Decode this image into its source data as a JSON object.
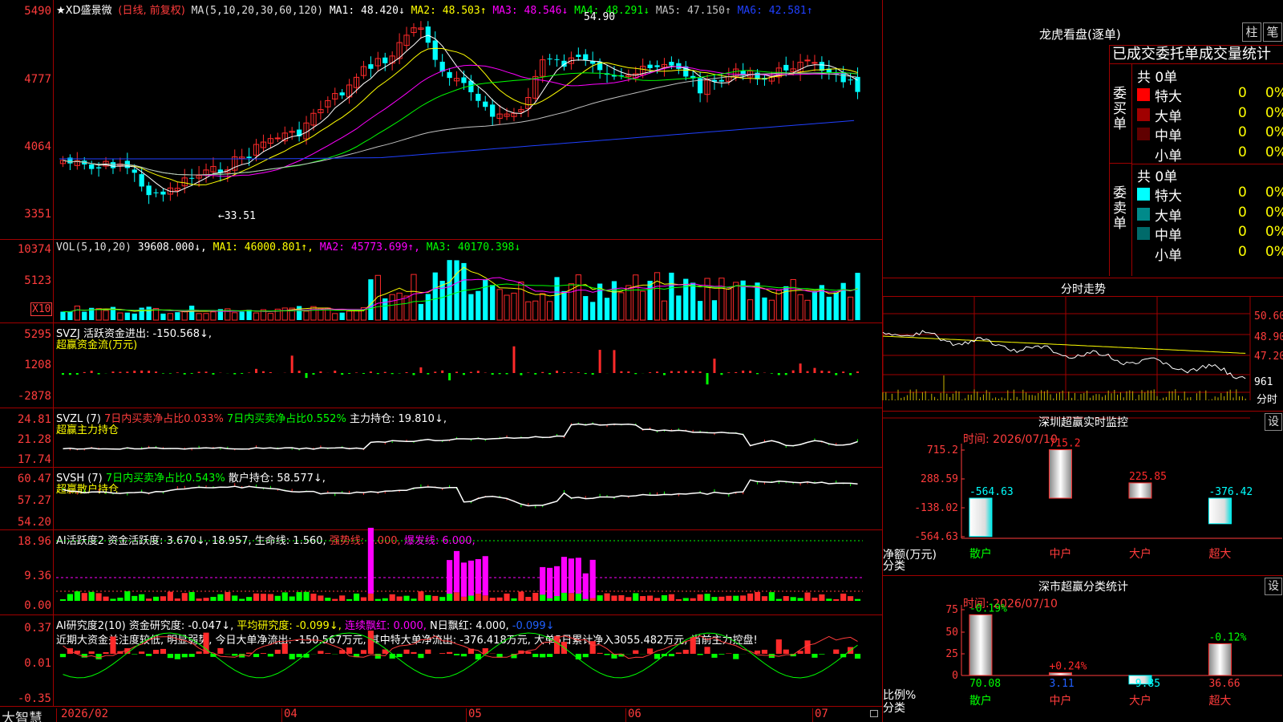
{
  "colors": {
    "up": "#ff2a2a",
    "down": "#00ffff",
    "bg": "#000000",
    "grid": "#a00000"
  },
  "price": {
    "stock_name": "★XD盛景微",
    "adjust": "(日线, 前复权)",
    "ma_params": "MA(5,10,20,30,60,120)",
    "ma": [
      {
        "label": "MA1: 48.420↓",
        "color": "#ffffff"
      },
      {
        "label": "MA2: 48.503↑",
        "color": "#ffff00"
      },
      {
        "label": "MA3: 48.546↓",
        "color": "#ff00ff"
      },
      {
        "label": "MA4: 48.291↓",
        "color": "#00ff00"
      },
      {
        "label": "MA5: 47.150↑",
        "color": "#c0c0c0"
      },
      {
        "label": "MA6: 42.581↑",
        "color": "#2040ff"
      }
    ],
    "y_labels": [
      "5490",
      "4777",
      "4064",
      "3351"
    ],
    "high_note": "54.90",
    "low_note": "←33.51"
  },
  "vol": {
    "title": "VOL(5,10,20)",
    "value": "39608.000↓,",
    "ma": [
      {
        "label": "MA1: 46000.801↑,",
        "color": "#ffff00"
      },
      {
        "label": "MA2: 45773.699↑,",
        "color": "#ff00ff"
      },
      {
        "label": "MA3: 40170.398↓",
        "color": "#00ff00"
      }
    ],
    "y_labels": [
      "10374",
      "5123"
    ],
    "unit": "X10"
  },
  "svzj": {
    "title": "SVZJ  活跃资金进出: -150.568↓,",
    "subtitle": "超赢资金流(万元)",
    "y_labels": [
      "5295",
      "1208",
      "-2878"
    ]
  },
  "svzl": {
    "name": "SVZL (7)",
    "t1": "7日内买卖净占比0.033%",
    "t2": "7日内买卖净占比0.552%",
    "t3": "主力持仓: 19.810↓,",
    "subtitle": "超赢主力持仓",
    "y_labels": [
      "24.81",
      "21.28",
      "17.74"
    ]
  },
  "svsh": {
    "name": "SVSH (7)",
    "t1": "7日内买卖净占比0.543%",
    "t2": "散户持仓: 58.577↓,",
    "subtitle": "超赢散户持仓",
    "y_labels": [
      "60.47",
      "57.27",
      "54.20"
    ]
  },
  "ai1": {
    "t1": "AI活跃度2 资金活跃度: 3.670↓,",
    "t2": "18.957,",
    "t3": "生命线: 1.560,",
    "t4": "强势线: 3.000,",
    "t5": "爆发线: 6.000,",
    "y_labels": [
      "18.96",
      "9.36",
      "0.00"
    ]
  },
  "ai2": {
    "t1": "AI研究度2(10) 资金研究度: -0.047↓,",
    "t2": "平均研究度: -0.099↓,",
    "t3": "连续飘红: 0.000,",
    "t4": "N日飘红: 4.000,",
    "t5": "-0.099↓",
    "note": "近期大资金关注度较低, 明显弱势, 今日大单净流出: -150.567万元, 其中特大单净流出: -376.418万元, 大单5日累计净入3055.482万元, 当前主力控盘!",
    "y_labels": [
      "0.37",
      "0.01",
      "-0.35"
    ]
  },
  "xaxis": {
    "brand": "大智慧",
    "labels": [
      "2026/02",
      "04",
      "05",
      "06",
      "07"
    ]
  },
  "longhu": {
    "title": "龙虎看盘(逐单)",
    "tab_bar": "柱",
    "tab_pen": "笔",
    "header": "已成交委托单成交量统计",
    "buy_label": "委买单",
    "sell_label": "委卖单",
    "buy_total": "共 0单",
    "sell_total": "共 0单",
    "buy_rows": [
      {
        "name": "特大",
        "n": "0",
        "pct": "0%",
        "color": "#ff0000"
      },
      {
        "name": "大单",
        "n": "0",
        "pct": "0%",
        "color": "#a00000"
      },
      {
        "name": "中单",
        "n": "0",
        "pct": "0%",
        "color": "#600000"
      },
      {
        "name": "小单",
        "n": "0",
        "pct": "0%",
        "color": "#000000"
      }
    ],
    "sell_rows": [
      {
        "name": "特大",
        "n": "0",
        "pct": "0%",
        "color": "#00ffff"
      },
      {
        "name": "大单",
        "n": "0",
        "pct": "0%",
        "color": "#008a8a"
      },
      {
        "name": "中单",
        "n": "0",
        "pct": "0%",
        "color": "#006a6a"
      },
      {
        "name": "小单",
        "n": "0",
        "pct": "0%",
        "color": "#000000"
      }
    ]
  },
  "intraday": {
    "title": "分时走势",
    "y_labels": [
      "50.60",
      "48.90",
      "47.20",
      "961"
    ],
    "unit": "分时"
  },
  "sz_monitor": {
    "title": "深圳超赢实时监控",
    "btn": "设",
    "date": "时间: 2026/07/10",
    "y_labels": [
      "715.2",
      "288.59",
      "-138.02",
      "-564.63"
    ],
    "ylabel": "净额(万元)",
    "xlabel": "分类",
    "categories": [
      "散户",
      "中户",
      "大户",
      "超大"
    ],
    "values": [
      -564.63,
      715.2,
      225.85,
      -376.42
    ],
    "value_labels": [
      "-564.63",
      "715.2",
      "225.85",
      "-376.42"
    ]
  },
  "sz_stats": {
    "title": "深市超赢分类统计",
    "btn": "设",
    "date": "时间: 2026/07/10",
    "y_labels": [
      "75",
      "50",
      "25",
      "0"
    ],
    "ylabel": "比例%",
    "xlabel": "分类",
    "categories": [
      "散户",
      "中户",
      "大户",
      "超大"
    ],
    "values": [
      70.08,
      3.11,
      -9.85,
      36.66
    ],
    "value_labels": [
      "70.08",
      "3.11",
      "-9.85",
      "36.66"
    ],
    "change_labels": [
      "-0.19%",
      "+0.24%",
      "",
      "-0.12%"
    ]
  }
}
